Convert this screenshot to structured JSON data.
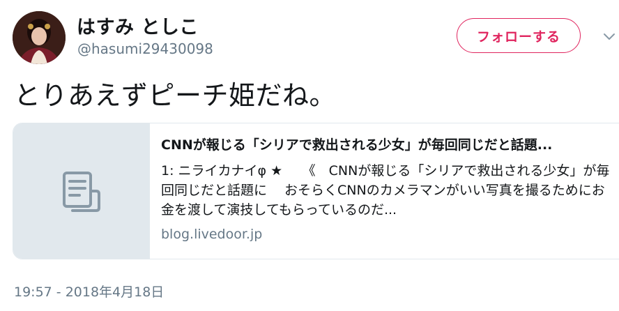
{
  "user": {
    "display_name": "はすみ としこ",
    "handle": "@hasumi29430098"
  },
  "actions": {
    "follow_label": "フォローする"
  },
  "tweet": {
    "text": "とりあえずピーチ姫だね。",
    "timestamp": "19:57 - 2018年4月18日"
  },
  "card": {
    "title": "CNNが報じる「シリアで救出される少女」が毎回同じだと話題...",
    "description": "1: ニライカナイφ ★　　《　CNNが報じる「シリアで救出される少女」が毎回同じだと話題に　 おそらくCNNのカメラマンがいい写真を撮るためにお金を渡して演技してもらっているのだ...",
    "domain": "blog.livedoor.jp"
  },
  "colors": {
    "follow_accent": "#e0245e",
    "secondary_text": "#657786",
    "card_border": "#e1e8ed",
    "thumb_bg": "#e1e8ed",
    "thumb_icon": "#8899a6"
  },
  "icons": {
    "avatar": "avatar",
    "chevron": "chevron-down-icon",
    "card_thumb": "document-icon"
  }
}
